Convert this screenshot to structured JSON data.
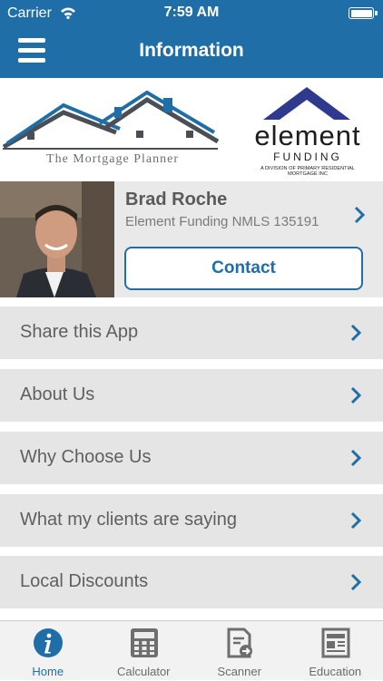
{
  "status_bar": {
    "carrier": "Carrier",
    "time": "7:59 AM"
  },
  "header": {
    "title": "Information"
  },
  "logos": {
    "mortgage_planner": "The Mortgage Planner",
    "element_name": "element",
    "element_sub": "FUNDING",
    "element_tagline": "A DIVISION OF PRIMARY RESIDENTIAL MORTGAGE INC"
  },
  "agent": {
    "name": "Brad Roche",
    "company": "Element Funding NMLS 135191",
    "contact_label": "Contact"
  },
  "menu": [
    {
      "label": "Share this App"
    },
    {
      "label": "About Us"
    },
    {
      "label": "Why Choose Us"
    },
    {
      "label": "What my clients are saying"
    },
    {
      "label": "Local Discounts"
    }
  ],
  "tabs": [
    {
      "label": "Home",
      "icon": "info-icon",
      "active": true
    },
    {
      "label": "Calculator",
      "icon": "calculator-icon",
      "active": false
    },
    {
      "label": "Scanner",
      "icon": "scanner-icon",
      "active": false
    },
    {
      "label": "Education",
      "icon": "newspaper-icon",
      "active": false
    }
  ],
  "colors": {
    "brand": "#1f6ea8",
    "row_bg": "#e5e5e5",
    "tab_bg": "#f2f2f2"
  }
}
